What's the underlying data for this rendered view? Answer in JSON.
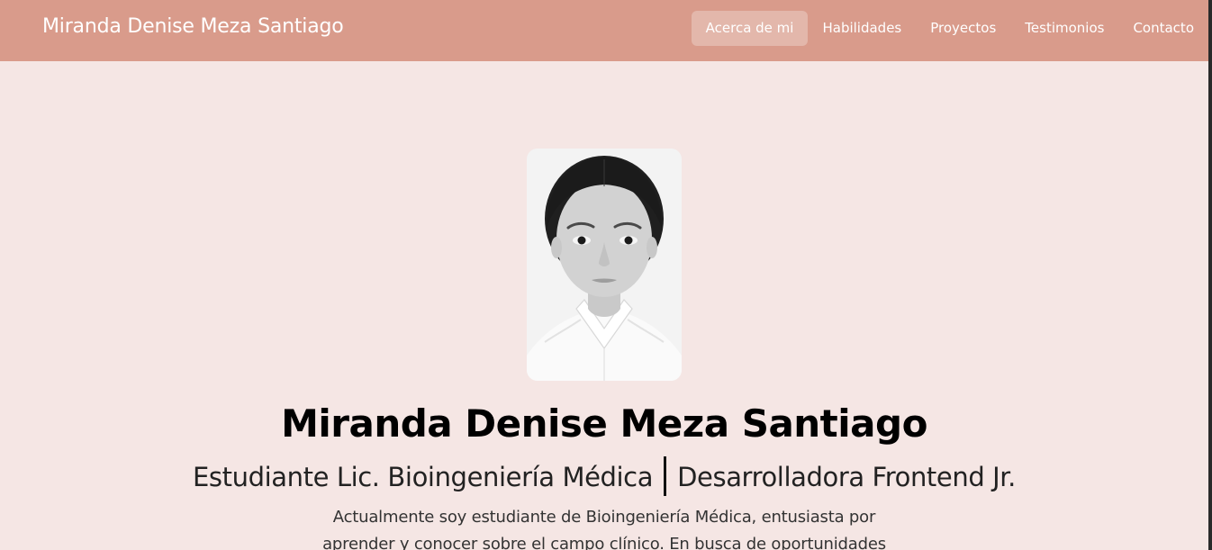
{
  "header": {
    "brand": "Miranda Denise Meza Santiago",
    "nav": [
      {
        "label": "Acerca de mi",
        "active": true
      },
      {
        "label": "Habilidades",
        "active": false
      },
      {
        "label": "Proyectos",
        "active": false
      },
      {
        "label": "Testimonios",
        "active": false
      },
      {
        "label": "Contacto",
        "active": false
      }
    ]
  },
  "hero": {
    "name": "Miranda Denise Meza Santiago",
    "role_primary": "Estudiante Lic. Bioingeniería Médica",
    "role_secondary": "Desarrolladora Frontend Jr.",
    "bio": "Actualmente soy estudiante de Bioingeniería Médica, entusiasta por aprender y conocer sobre el campo clínico. En busca de oportunidades"
  },
  "colors": {
    "navbar": "#d99b8b",
    "background": "#f5e6e4",
    "nav_active": "rgba(255,255,255,0.28)",
    "text_dark": "#000000"
  }
}
